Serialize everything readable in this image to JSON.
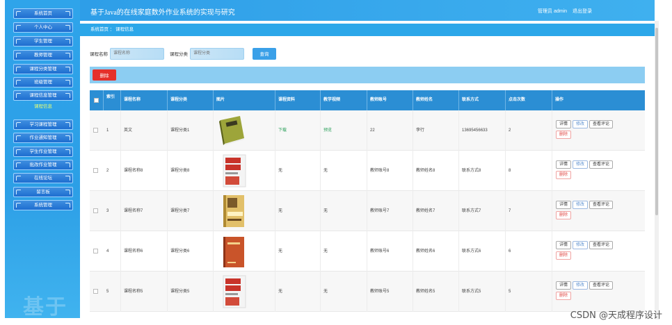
{
  "sidebar": {
    "items": [
      {
        "label": "系统首页"
      },
      {
        "label": "个人中心"
      },
      {
        "label": "学生管理"
      },
      {
        "label": "教师管理"
      },
      {
        "label": "课程分类管理"
      },
      {
        "label": "班级管理"
      },
      {
        "label": "课程信息管理"
      },
      {
        "label": "学习课程管理"
      },
      {
        "label": "作业通知管理"
      },
      {
        "label": "学生作业管理"
      },
      {
        "label": "批改作业管理"
      },
      {
        "label": "在线论坛"
      },
      {
        "label": "留言板"
      },
      {
        "label": "系统管理"
      }
    ],
    "active": "课程信息"
  },
  "header": {
    "title": "基于Java的在线家庭数外作业系统的实现与研究",
    "user_role": "管理员 admin",
    "logout": "退出登录"
  },
  "breadcrumb": "系统首页 ： 课程信息",
  "search": {
    "name_label": "课程名称",
    "name_placeholder": "课程名称",
    "type_label": "课程分类",
    "type_placeholder": "课程分类",
    "button": "查询"
  },
  "actions": {
    "delete": "删除"
  },
  "table": {
    "columns": [
      "索引",
      "课程名称",
      "课程分类",
      "图片",
      "课程资料",
      "教学视频",
      "教师账号",
      "教师姓名",
      "联系方式",
      "点击次数",
      "操作"
    ],
    "rows": [
      {
        "index": "1",
        "name": "英文",
        "type": "课程分类1",
        "material": "下载",
        "video": "预览",
        "teacher_id": "22",
        "teacher_name": "李行",
        "contact": "13695456633",
        "clicks": "2"
      },
      {
        "index": "2",
        "name": "课程名称8",
        "type": "课程分类8",
        "material": "无",
        "video": "无",
        "teacher_id": "教师账号8",
        "teacher_name": "教师姓名8",
        "contact": "联系方式8",
        "clicks": "8"
      },
      {
        "index": "3",
        "name": "课程名称7",
        "type": "课程分类7",
        "material": "无",
        "video": "无",
        "teacher_id": "教师账号7",
        "teacher_name": "教师姓名7",
        "contact": "联系方式7",
        "clicks": "7"
      },
      {
        "index": "4",
        "name": "课程名称6",
        "type": "课程分类6",
        "material": "无",
        "video": "无",
        "teacher_id": "教师账号6",
        "teacher_name": "教师姓名6",
        "contact": "联系方式6",
        "clicks": "6"
      },
      {
        "index": "5",
        "name": "课程名称5",
        "type": "课程分类5",
        "material": "无",
        "video": "无",
        "teacher_id": "教师账号5",
        "teacher_name": "教师姓名5",
        "contact": "联系方式5",
        "clicks": "5"
      }
    ],
    "ops": {
      "detail": "详情",
      "edit": "修改",
      "review": "查看评论",
      "delete": "删除"
    }
  },
  "watermark": "CSDN @天成程序设计",
  "side_watermark": "基于",
  "colors": {
    "primary": "#2ca7e9",
    "header": "#2b8ed4",
    "danger": "#e5302b"
  }
}
